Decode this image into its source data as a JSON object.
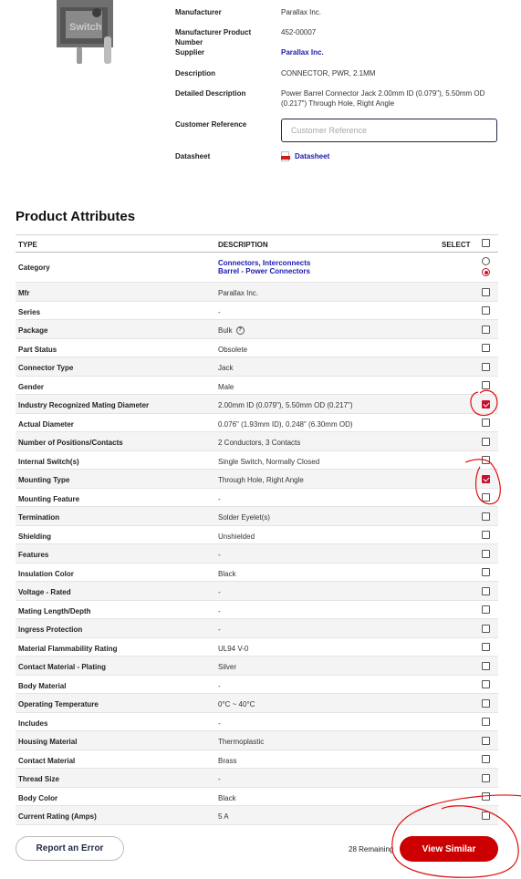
{
  "details": {
    "manufacturer_label": "Manufacturer",
    "manufacturer_value": "Parallax Inc.",
    "mpn_label": "Manufacturer Product Number",
    "mpn_value": "452-00007",
    "supplier_label": "Supplier",
    "supplier_value": "Parallax Inc.",
    "description_label": "Description",
    "description_value": "CONNECTOR, PWR, 2.1MM",
    "detailed_label": "Detailed Description",
    "detailed_value": "Power Barrel Connector Jack 2.00mm ID (0.079\"), 5.50mm OD (0.217\") Through Hole, Right Angle",
    "customer_ref_label": "Customer Reference",
    "customer_ref_placeholder": "Customer Reference",
    "datasheet_label": "Datasheet",
    "datasheet_link": "Datasheet",
    "pdf_icon": "pdf-icon"
  },
  "attributes": {
    "title": "Product Attributes",
    "header": {
      "type": "TYPE",
      "description": "DESCRIPTION",
      "select": "SELECT"
    },
    "rows": [
      {
        "type": "Category",
        "desc": "",
        "links": [
          "Connectors, Interconnects",
          "Barrel - Power Connectors"
        ],
        "control": "radio"
      },
      {
        "type": "Mfr",
        "desc": "Parallax Inc.",
        "checked": false
      },
      {
        "type": "Series",
        "desc": "-",
        "checked": false
      },
      {
        "type": "Package",
        "desc": "Bulk",
        "help": true,
        "checked": false
      },
      {
        "type": "Part Status",
        "desc": "Obsolete",
        "checked": false
      },
      {
        "type": "Connector Type",
        "desc": "Jack",
        "checked": false
      },
      {
        "type": "Gender",
        "desc": "Male",
        "checked": false
      },
      {
        "type": "Industry Recognized Mating Diameter",
        "desc": "2.00mm ID (0.079\"), 5.50mm OD (0.217\")",
        "checked": true
      },
      {
        "type": "Actual Diameter",
        "desc": "0.076\" (1.93mm ID), 0.248\" (6.30mm OD)",
        "checked": false
      },
      {
        "type": "Number of Positions/Contacts",
        "desc": "2 Conductors, 3 Contacts",
        "checked": false
      },
      {
        "type": "Internal Switch(s)",
        "desc": "Single Switch, Normally Closed",
        "checked": false
      },
      {
        "type": "Mounting Type",
        "desc": "Through Hole, Right Angle",
        "checked": true
      },
      {
        "type": "Mounting Feature",
        "desc": "-",
        "checked": false
      },
      {
        "type": "Termination",
        "desc": "Solder Eyelet(s)",
        "checked": false
      },
      {
        "type": "Shielding",
        "desc": "Unshielded",
        "checked": false
      },
      {
        "type": "Features",
        "desc": "-",
        "checked": false
      },
      {
        "type": "Insulation Color",
        "desc": "Black",
        "checked": false
      },
      {
        "type": "Voltage - Rated",
        "desc": "-",
        "checked": false
      },
      {
        "type": "Mating Length/Depth",
        "desc": "-",
        "checked": false
      },
      {
        "type": "Ingress Protection",
        "desc": "-",
        "checked": false
      },
      {
        "type": "Material Flammability Rating",
        "desc": "UL94 V-0",
        "checked": false
      },
      {
        "type": "Contact Material - Plating",
        "desc": "Silver",
        "checked": false
      },
      {
        "type": "Body Material",
        "desc": "-",
        "checked": false
      },
      {
        "type": "Operating Temperature",
        "desc": "0°C ~ 40°C",
        "checked": false
      },
      {
        "type": "Includes",
        "desc": "-",
        "checked": false
      },
      {
        "type": "Housing Material",
        "desc": "Thermoplastic",
        "checked": false
      },
      {
        "type": "Contact Material",
        "desc": "Brass",
        "checked": false
      },
      {
        "type": "Thread Size",
        "desc": "-",
        "checked": false
      },
      {
        "type": "Body Color",
        "desc": "Black",
        "checked": false
      },
      {
        "type": "Current Rating (Amps)",
        "desc": "5 A",
        "checked": false
      }
    ]
  },
  "footer": {
    "report_label": "Report an Error",
    "remaining_text": "28 Remaining",
    "view_similar_label": "View Similar"
  },
  "colors": {
    "accent": "#cc0000",
    "link": "#1a1ab0",
    "annotation": "#e01010"
  }
}
